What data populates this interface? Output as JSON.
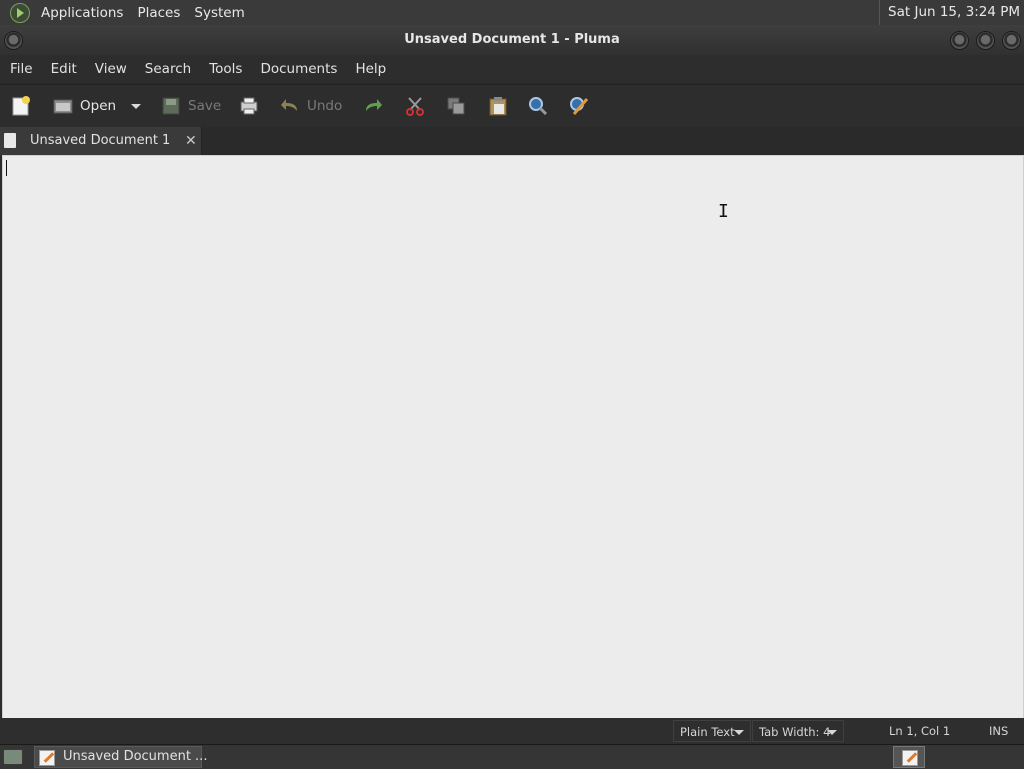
{
  "top_panel": {
    "menus": [
      "Applications",
      "Places",
      "System"
    ],
    "clock": "Sat Jun 15,  3:24 PM"
  },
  "window": {
    "title": "Unsaved Document 1 - Pluma"
  },
  "menubar": [
    "File",
    "Edit",
    "View",
    "Search",
    "Tools",
    "Documents",
    "Help"
  ],
  "toolbar": {
    "open_label": "Open",
    "save_label": "Save",
    "undo_label": "Undo",
    "icons": [
      "new-document-icon",
      "open-icon",
      "open-dropdown-icon",
      "save-icon",
      "print-icon",
      "undo-icon",
      "redo-icon",
      "cut-icon",
      "copy-icon",
      "paste-icon",
      "find-icon",
      "replace-icon"
    ]
  },
  "tabs": [
    {
      "label": "Unsaved Document 1",
      "close": "✕"
    }
  ],
  "editor": {
    "content": ""
  },
  "statusbar": {
    "language": "Plain Text",
    "tab_width": "Tab Width:  4",
    "position": "Ln 1, Col 1",
    "mode": "INS"
  },
  "taskbar": {
    "window_label": "Unsaved Document ..."
  },
  "colors": {
    "panel": "#3a3a3a",
    "toolbar": "#2d2d2d",
    "editor_bg": "#ececec",
    "accent_green": "#7aa35a"
  }
}
